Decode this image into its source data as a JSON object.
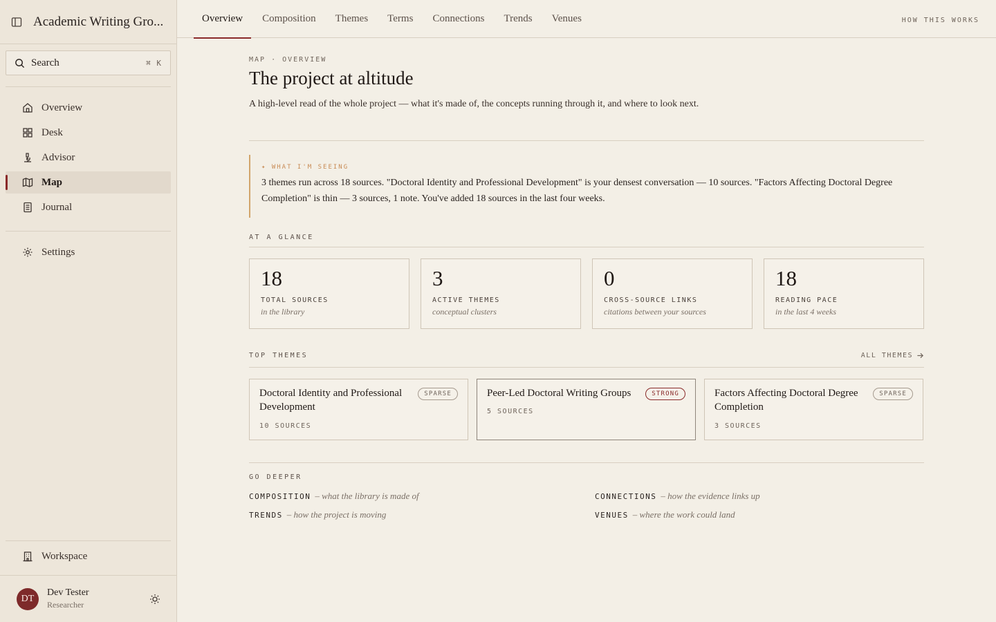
{
  "app": {
    "title": "Academic Writing Gro..."
  },
  "search": {
    "label": "Search",
    "shortcut": "⌘ K"
  },
  "sidebar": {
    "items": [
      {
        "label": "Overview",
        "icon": "home-icon"
      },
      {
        "label": "Desk",
        "icon": "grid-icon"
      },
      {
        "label": "Advisor",
        "icon": "microscope-icon"
      },
      {
        "label": "Map",
        "icon": "map-icon",
        "active": true
      },
      {
        "label": "Journal",
        "icon": "notebook-icon"
      }
    ],
    "settings": {
      "label": "Settings",
      "icon": "gear-icon"
    },
    "workspace": {
      "label": "Workspace",
      "icon": "building-icon"
    }
  },
  "user": {
    "initials": "DT",
    "name": "Dev Tester",
    "role": "Researcher"
  },
  "tabs": [
    "Overview",
    "Composition",
    "Themes",
    "Terms",
    "Connections",
    "Trends",
    "Venues"
  ],
  "how_link": "HOW THIS WORKS",
  "page": {
    "eyebrow": "MAP · OVERVIEW",
    "title": "The project at altitude",
    "lede": "A high-level read of the whole project — what it's made of, the concepts running through it, and where to look next."
  },
  "seeing": {
    "tag": "✦ WHAT I'M SEEING",
    "text": "3 themes run across 18 sources. \"Doctoral Identity and Professional Development\" is your densest conversation — 10 sources. \"Factors Affecting Doctoral Degree Completion\" is thin — 3 sources, 1 note. You've added 18 sources in the last four weeks."
  },
  "glance": {
    "heading": "AT A GLANCE",
    "stats": [
      {
        "num": "18",
        "label": "TOTAL SOURCES",
        "sub": "in the library"
      },
      {
        "num": "3",
        "label": "ACTIVE THEMES",
        "sub": "conceptual clusters"
      },
      {
        "num": "0",
        "label": "CROSS-SOURCE LINKS",
        "sub": "citations between your sources"
      },
      {
        "num": "18",
        "label": "READING PACE",
        "sub": "in the last 4 weeks"
      }
    ]
  },
  "top_themes": {
    "heading": "TOP THEMES",
    "all_link": "ALL THEMES",
    "items": [
      {
        "name": "Doctoral Identity and Professional Development",
        "badge": "SPARSE",
        "count": "10 SOURCES"
      },
      {
        "name": "Peer-Led Doctoral Writing Groups",
        "badge": "STRONG",
        "count": "5 SOURCES"
      },
      {
        "name": "Factors Affecting Doctoral Degree Completion",
        "badge": "SPARSE",
        "count": "3 SOURCES"
      }
    ]
  },
  "deeper": {
    "heading": "GO DEEPER",
    "links": [
      {
        "label": "COMPOSITION",
        "desc": "– what the library is made of"
      },
      {
        "label": "CONNECTIONS",
        "desc": "– how the evidence links up"
      },
      {
        "label": "TRENDS",
        "desc": "– how the project is moving"
      },
      {
        "label": "VENUES",
        "desc": "– where the work could land"
      }
    ]
  },
  "colors": {
    "accent": "#8a2a2a",
    "highlight": "#d2a56b",
    "background": "#f3efe6",
    "sidebar": "#ede6da"
  }
}
